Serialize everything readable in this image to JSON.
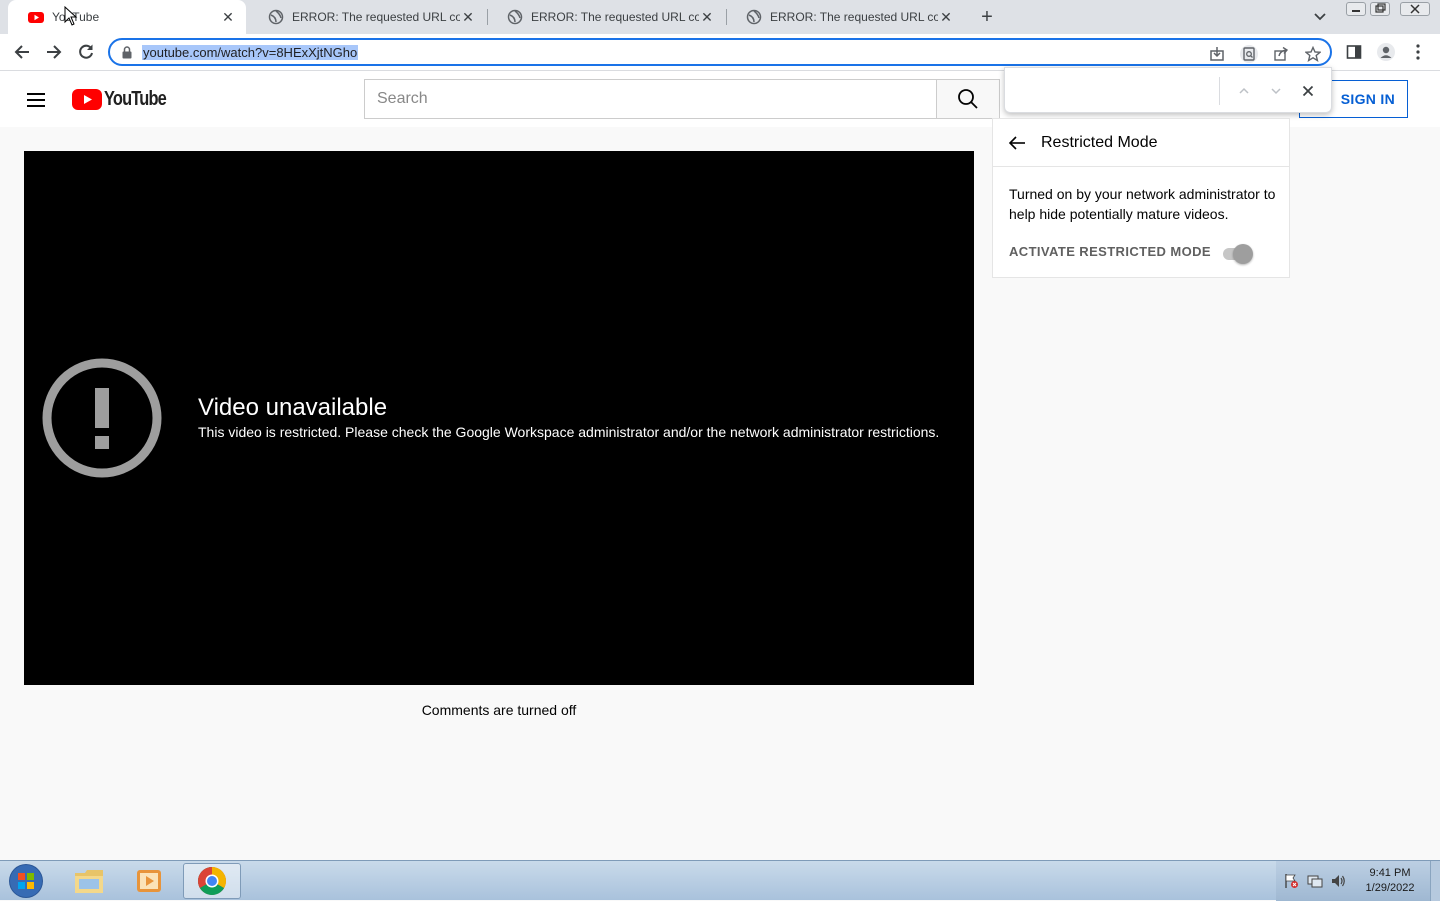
{
  "browser": {
    "tabs": [
      {
        "title": "YouTube",
        "active": true,
        "favicon": "youtube-favicon"
      },
      {
        "title": "ERROR: The requested URL could not be retrieved",
        "active": false,
        "favicon": "globe-icon"
      },
      {
        "title": "ERROR: The requested URL could not be retrieved",
        "active": false,
        "favicon": "globe-icon"
      },
      {
        "title": "ERROR: The requested URL could not be retrieved",
        "active": false,
        "favicon": "globe-icon"
      }
    ],
    "new_tab_symbol": "+",
    "close_symbol": "✕",
    "url": "youtube.com/watch?v=8HExXjtNGho"
  },
  "youtube": {
    "logo_text": "YouTube",
    "search_placeholder": "Search",
    "sign_in_label": "SIGN IN"
  },
  "find_bar": {
    "query": ""
  },
  "restricted_mode": {
    "title": "Restricted Mode",
    "description": "Turned on by your network administrator to help hide potentially mature videos.",
    "toggle_label": "ACTIVATE RESTRICTED MODE",
    "toggle_on": true,
    "toggle_disabled": true
  },
  "player": {
    "error_title": "Video unavailable",
    "error_message": "This video is restricted. Please check the Google Workspace administrator and/or the network administrator restrictions."
  },
  "comments": {
    "status": "Comments are turned off"
  },
  "taskbar": {
    "apps": [
      "windows-start",
      "file-explorer",
      "media-player",
      "google-chrome"
    ],
    "time": "9:41 PM",
    "date": "1/29/2022"
  },
  "colors": {
    "youtube_red": "#ff0000",
    "signin_blue": "#065fd4",
    "focus_blue": "#1a73e8",
    "player_bg": "#000000"
  }
}
